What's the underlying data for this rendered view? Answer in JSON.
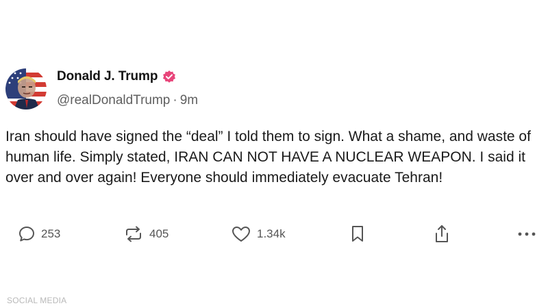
{
  "post": {
    "author": {
      "display_name": "Donald J. Trump",
      "handle": "@realDonaldTrump",
      "separator": "·",
      "time_ago": "9m",
      "verified_color": "#e8457a"
    },
    "text": "Iran should have signed the “deal” I told them to sign. What a shame, and waste of human life. Simply stated, IRAN CAN NOT HAVE A NUCLEAR WEAPON. I said it over and over again! Everyone should immediately evacuate Tehran!",
    "actions": {
      "reply_count": "253",
      "repost_count": "405",
      "like_count": "1.34k",
      "icons": [
        "reply-icon",
        "repost-icon",
        "like-icon",
        "bookmark-icon",
        "share-icon",
        "more-icon"
      ]
    }
  },
  "watermark": "SOCIAL MEDIA"
}
